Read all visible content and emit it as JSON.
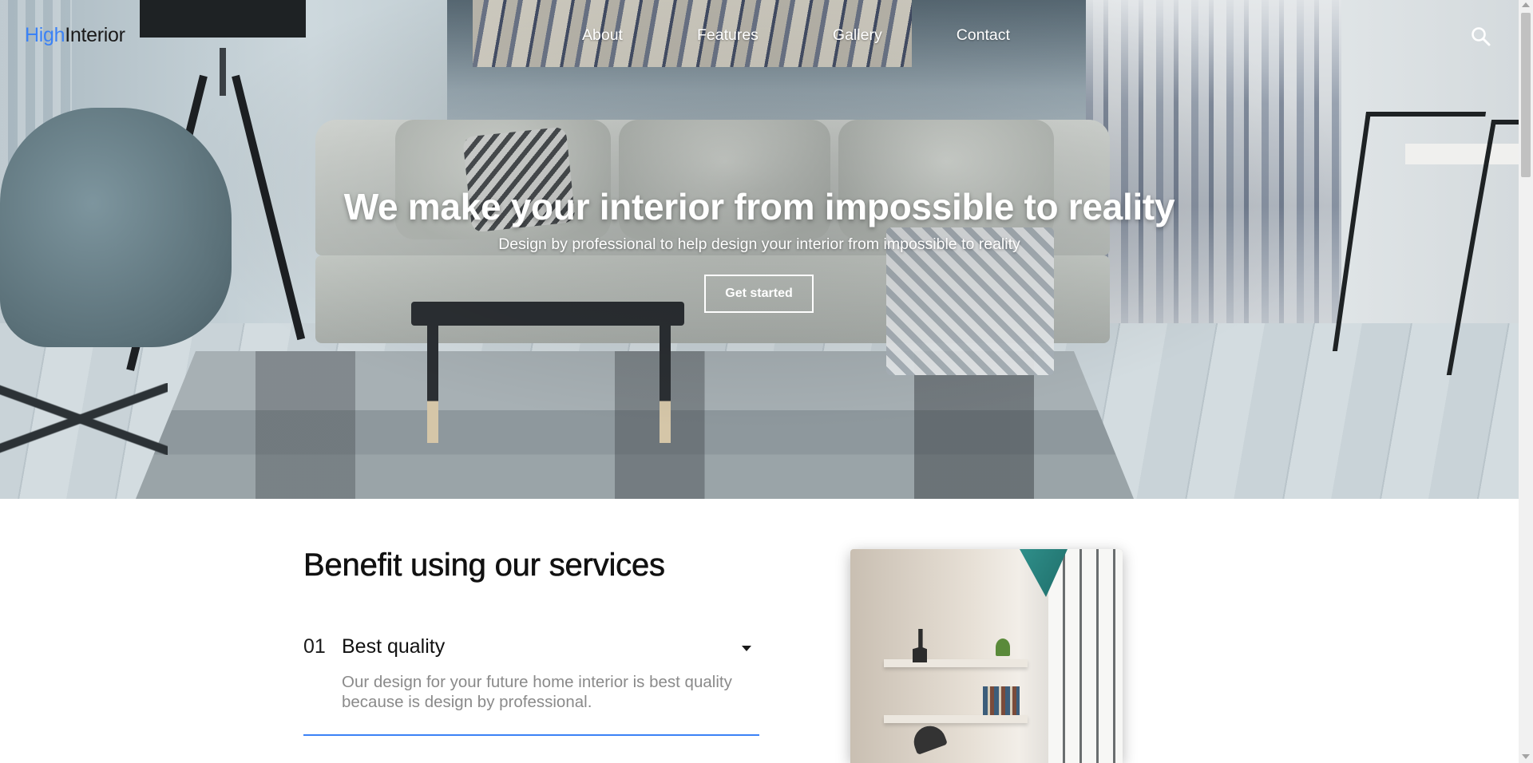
{
  "nav": {
    "logo_accent": "High",
    "logo_rest": "Interior",
    "links": [
      {
        "label": "About"
      },
      {
        "label": "Features"
      },
      {
        "label": "Gallery"
      },
      {
        "label": "Contact"
      }
    ],
    "search_icon": "search-icon"
  },
  "hero": {
    "title": "We make your interior from impossible to reality",
    "subtitle": "Design by professional to help design your interior from impossible to reality",
    "cta_label": "Get started"
  },
  "benefits": {
    "title": "Benefit using our services",
    "items": [
      {
        "number": "01",
        "label": "Best quality",
        "description": "Our design for your future home interior is best quality because is design by professional.",
        "expanded": true
      }
    ]
  },
  "colors": {
    "accent": "#3b82f6",
    "text_dark": "#111111",
    "text_muted": "#8a8a8a"
  }
}
